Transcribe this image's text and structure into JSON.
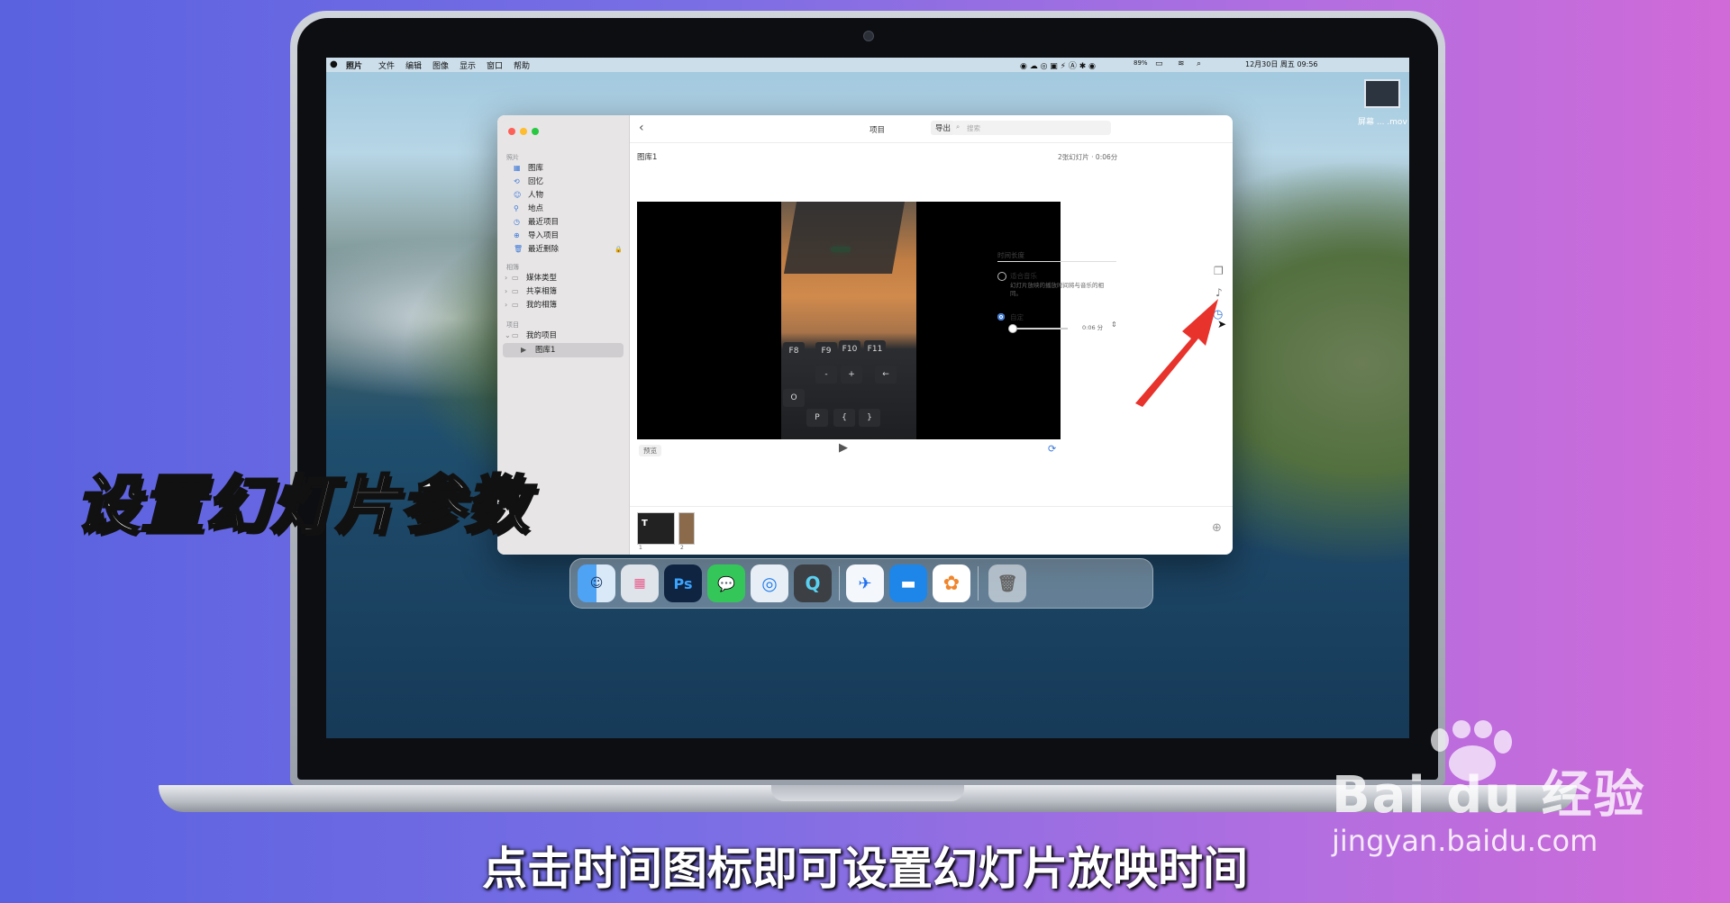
{
  "menubar": {
    "apple": "",
    "items": [
      "照片",
      "文件",
      "编辑",
      "图像",
      "显示",
      "窗口",
      "帮助"
    ],
    "battery": "89%",
    "datetime": "12月30日 周五 09:56"
  },
  "desktop": {
    "file_label": "屏幕 ... .mov"
  },
  "sidebar": {
    "section_photos": "照片",
    "photos_items": [
      "图库",
      "回忆",
      "人物",
      "地点",
      "最近项目",
      "导入项目",
      "最近删除"
    ],
    "section_albums": "相簿",
    "album_items": [
      "媒体类型",
      "共享相簿",
      "我的相簿"
    ],
    "section_projects": "项目",
    "project_items": [
      "我的项目",
      "图库1"
    ]
  },
  "toolbar": {
    "back": "‹",
    "title": "项目",
    "export_label": "导出",
    "search_placeholder": "搜索"
  },
  "project": {
    "name": "图库1",
    "summary": "2张幻灯片 · 0:06分",
    "preview_label": "预览"
  },
  "duration_panel": {
    "heading": "时间长度",
    "fit_music_label": "适合音乐",
    "fit_music_desc": "幻灯片放映的播放时间将与音乐的相同。",
    "custom_label": "自定",
    "custom_value": "0:06 分",
    "custom_selected": true
  },
  "thumbnails": [
    "1",
    "2"
  ],
  "keyboard_keys": [
    "F8",
    "F9",
    "F10",
    "F11",
    "-",
    "+",
    "←",
    "O",
    "P",
    "{",
    "}"
  ],
  "dock": [
    "Finder",
    "Launchpad",
    "Ps",
    "信息",
    "Safari",
    "QuickTime",
    "飞书",
    "Keynote",
    "照片",
    "废纸篓"
  ],
  "overlay": {
    "title": "设置幻灯片参数",
    "subtitle": "点击时间图标即可设置幻灯片放映时间"
  },
  "watermark": {
    "brand": "Bai du 经验",
    "url": "jingyan.baidu.com"
  },
  "colors": {
    "accent": "#3a78d8",
    "arrow": "#e8322c"
  }
}
